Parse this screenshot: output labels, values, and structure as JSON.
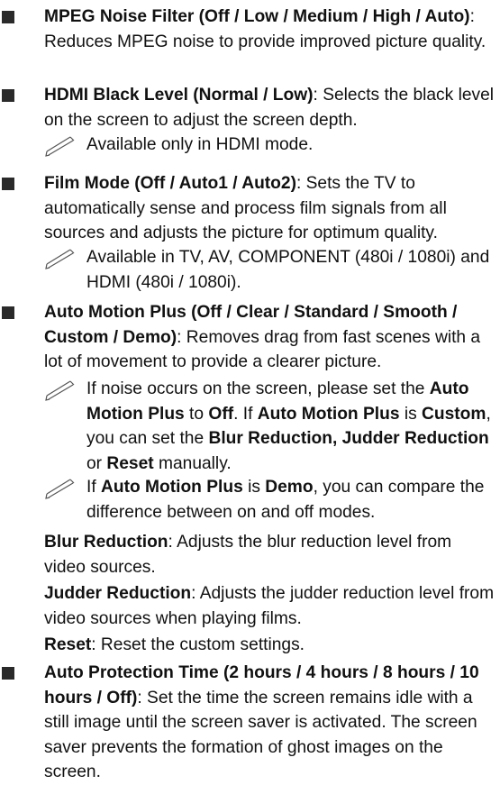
{
  "items": [
    {
      "title": "MPEG Noise Filter (Off / Low / Medium / High / Auto)",
      "desc": ": Reduces MPEG noise to provide improved picture quality."
    },
    {
      "title": "HDMI Black Level (Normal / Low)",
      "desc": ": Selects the black level on the screen to adjust the screen depth.",
      "note": "Available only in HDMI mode."
    },
    {
      "title": "Film Mode (Off / Auto1 / Auto2)",
      "desc": ": Sets the TV to automatically sense and process film signals from all sources and adjusts the picture for optimum quality.",
      "note": "Available in TV, AV, COMPONENT (480i / 1080i) and HDMI (480i / 1080i)."
    },
    {
      "title": "Auto Motion Plus (Off / Clear / Standard / Smooth / Custom / Demo)",
      "desc": ": Removes drag from fast scenes with a lot of movement to provide a clearer picture.",
      "note1": {
        "t1": "If noise occurs on the screen, please set the ",
        "b1": "Auto Motion Plus",
        "t2": " to ",
        "b2": "Off",
        "t3": ". If ",
        "b3": "Auto Motion Plus",
        "t4": " is ",
        "b4": "Custom",
        "t5": ", you can set the ",
        "b5": "Blur Reduction, Judder Reduction",
        "t6": " or ",
        "b6": "Reset",
        "t7": " manually."
      },
      "note2": {
        "t1": "If ",
        "b1": "Auto Motion Plus",
        "t2": " is ",
        "b2": "Demo",
        "t3": ", you can compare the difference between on and off modes."
      },
      "sub": [
        {
          "label": "Blur Reduction",
          "text": ": Adjusts the blur reduction level from video sources."
        },
        {
          "label": "Judder Reduction",
          "text": ": Adjusts the judder reduction level from video sources when playing films."
        },
        {
          "label": "Reset",
          "text": ": Reset the custom settings."
        }
      ]
    },
    {
      "title": "Auto Protection Time (2 hours / 4 hours / 8 hours / 10 hours / Off)",
      "desc": ": Set the time the screen remains idle with a still image until the screen saver is activated. The screen saver prevents the formation of ghost images on the screen."
    }
  ]
}
